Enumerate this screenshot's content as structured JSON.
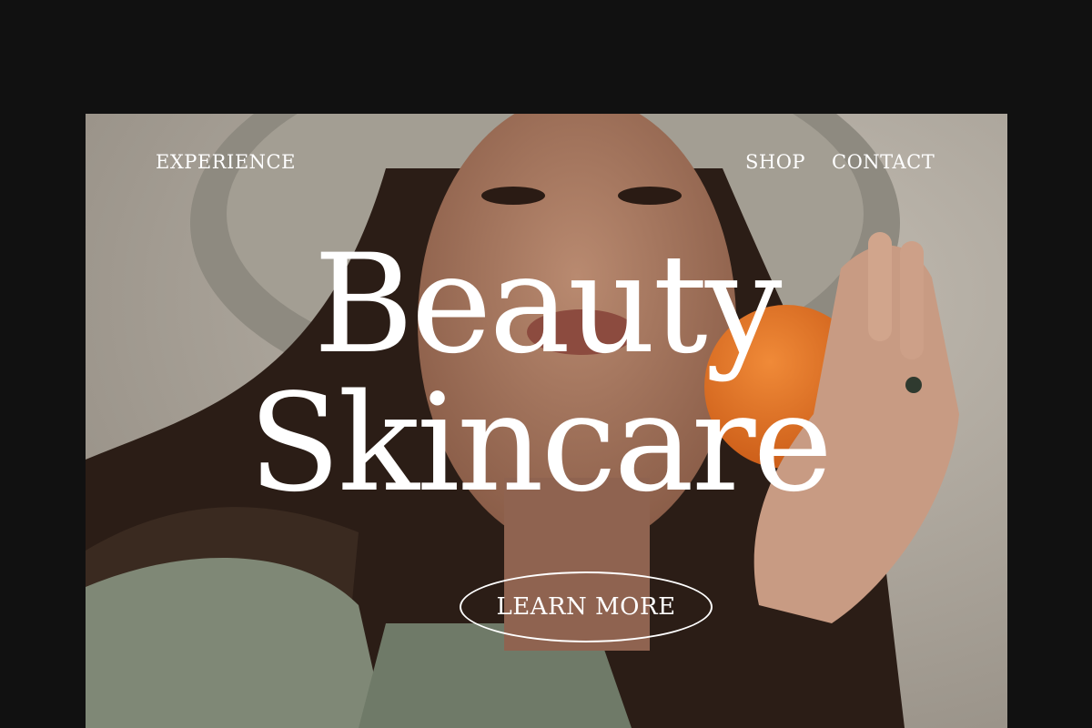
{
  "nav": {
    "experience": "EXPERIENCE",
    "shop": "SHOP",
    "contact": "CONTACT"
  },
  "hero": {
    "headline_line1": "Beauty",
    "headline_line2": "Skincare",
    "cta_label": "LEARN MORE"
  },
  "colors": {
    "page_background": "#111111",
    "text": "#ffffff",
    "orange": "#e8762a"
  }
}
